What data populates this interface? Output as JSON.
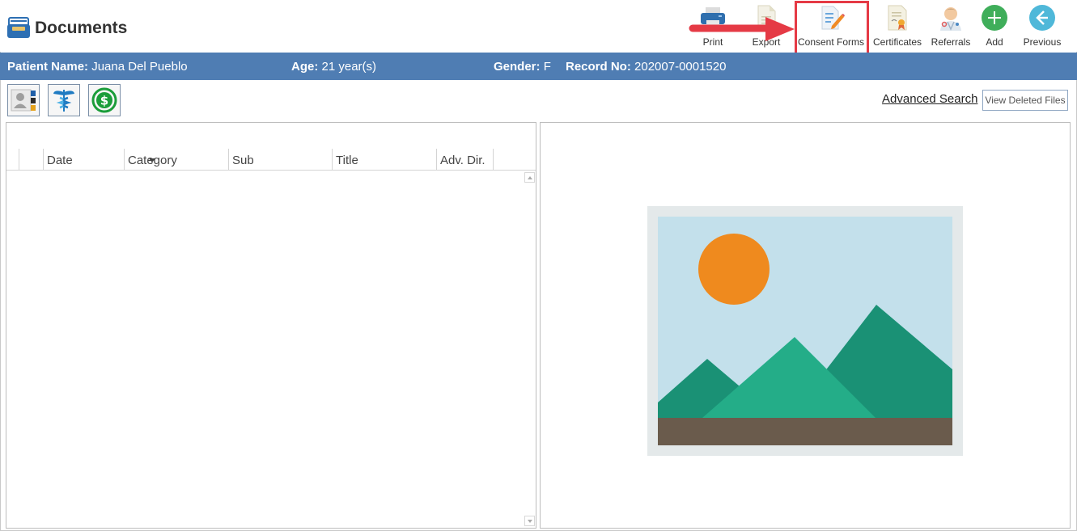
{
  "app": {
    "title": "Documents"
  },
  "toolbar": {
    "print_label": "Print",
    "export_label": "Export",
    "consent_label": "Consent Forms",
    "certificates_label": "Certificates",
    "referrals_label": "Referrals",
    "add_label": "Add",
    "previous_label": "Previous"
  },
  "patient": {
    "name_label": "Patient Name:",
    "name": "Juana Del Pueblo",
    "age_label": "Age:",
    "age": "21 year(s)",
    "gender_label": "Gender:",
    "gender": "F",
    "record_label": "Record No:",
    "record": "202007-0001520"
  },
  "actions": {
    "advanced_search": "Advanced Search",
    "view_deleted": "View Deleted Files"
  },
  "grid": {
    "columns": [
      "Date",
      "Category",
      "Sub",
      "Title",
      "Adv. Dir."
    ]
  },
  "colors": {
    "accent_bar": "#4f7db3",
    "highlight": "#e53a45",
    "add_green": "#3fae5a",
    "previous_teal": "#4fb8d9"
  },
  "icons": {
    "logo": "documents-tray-icon",
    "print": "printer-icon",
    "export": "export-document-icon",
    "consent": "consent-form-pencil-icon",
    "certificates": "certificate-ribbon-icon",
    "referrals": "doctor-referral-icon",
    "add": "plus-circle-icon",
    "previous": "arrow-left-circle-icon"
  }
}
